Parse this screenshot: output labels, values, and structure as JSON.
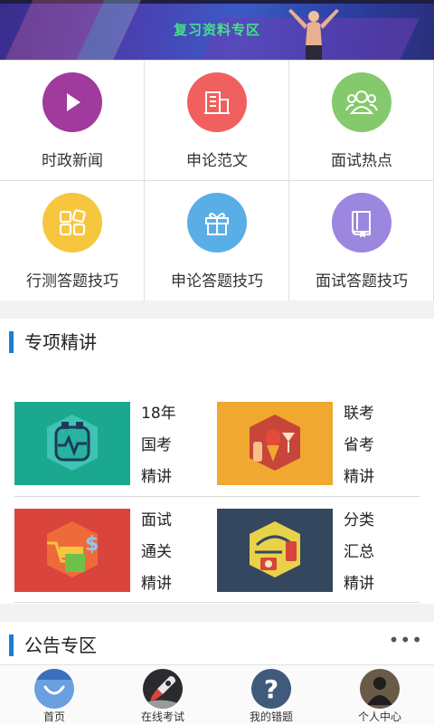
{
  "banner": {
    "title": "复习资料专区"
  },
  "grid": {
    "items": [
      {
        "label": "时政新闻",
        "color": "#a03a9c",
        "icon": "play-icon"
      },
      {
        "label": "申论范文",
        "color": "#f0605e",
        "icon": "building-icon"
      },
      {
        "label": "面试热点",
        "color": "#84c96b",
        "icon": "people-icon"
      },
      {
        "label": "行测答题技巧",
        "color": "#f6c63f",
        "icon": "grid-apps-icon"
      },
      {
        "label": "申论答题技巧",
        "color": "#5aaee6",
        "icon": "gift-icon"
      },
      {
        "label": "面试答题技巧",
        "color": "#9b86e0",
        "icon": "book-icon"
      }
    ]
  },
  "special": {
    "title": "专项精讲",
    "cards": [
      {
        "lines": [
          "18年",
          "国考",
          "精讲"
        ],
        "bg": "#1aa98f",
        "icon": "heart-pulse-icon"
      },
      {
        "lines": [
          "联考",
          "省考",
          "精讲"
        ],
        "bg": "#f0a830",
        "icon": "food-drink-icon"
      },
      {
        "lines": [
          "面试",
          "通关",
          "精讲"
        ],
        "bg": "#d9443d",
        "icon": "shopping-icon"
      },
      {
        "lines": [
          "分类",
          "汇总",
          "精讲"
        ],
        "bg": "#34475f",
        "icon": "tools-icon"
      }
    ]
  },
  "notice": {
    "title": "公告专区",
    "more": "•••"
  },
  "nav": {
    "items": [
      {
        "label": "首页",
        "icon": "home-icon"
      },
      {
        "label": "在线考试",
        "icon": "rocket-icon"
      },
      {
        "label": "我的错题",
        "icon": "question-icon"
      },
      {
        "label": "个人中心",
        "icon": "user-icon"
      }
    ]
  }
}
